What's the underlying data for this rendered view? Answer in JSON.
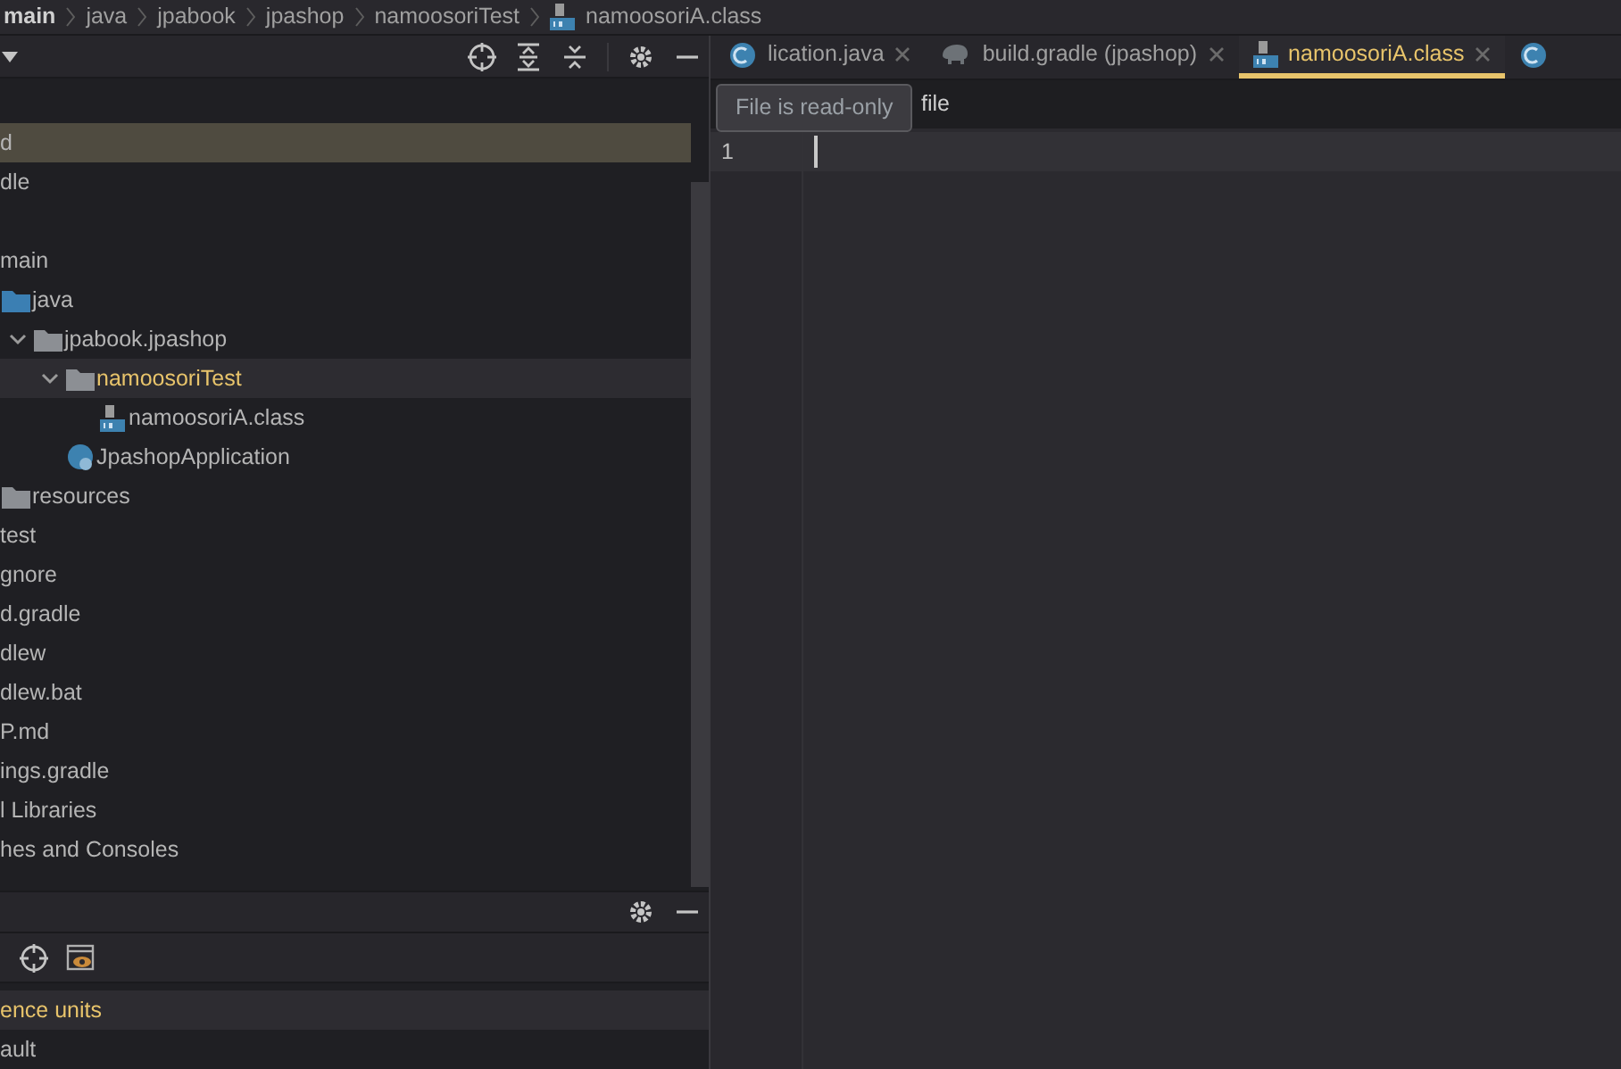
{
  "breadcrumb": [
    "main",
    "java",
    "jpabook",
    "jpashop",
    "namoosoriTest",
    {
      "label": "namoosoriA.class",
      "kind": "class"
    }
  ],
  "project_tree": [
    {
      "label": "d",
      "highlighted": true,
      "selected": false
    },
    {
      "label": "dle",
      "highlighted": false,
      "selected": false
    },
    {
      "highlighted": false,
      "selected": false,
      "children": [
        {
          "label": "main",
          "highlighted": false,
          "selected": false,
          "children": [
            {
              "label": "java",
              "kind": "source-folder",
              "highlighted": false,
              "selected": false,
              "children": [
                {
                  "label": "jpabook.jpashop",
                  "kind": "package",
                  "expanded": true,
                  "highlighted": false,
                  "selected": false,
                  "children": [
                    {
                      "label": "namoosoriTest",
                      "kind": "package",
                      "expanded": true,
                      "highlighted": false,
                      "selected": true,
                      "children": [
                        {
                          "label": "namoosoriA.class",
                          "kind": "class",
                          "highlighted": false,
                          "selected": false
                        }
                      ]
                    },
                    {
                      "label": "JpashopApplication",
                      "kind": "spring",
                      "highlighted": false,
                      "selected": false
                    }
                  ]
                }
              ]
            },
            {
              "label": "resources",
              "kind": "resources",
              "highlighted": false,
              "selected": false
            }
          ]
        },
        {
          "label": "test",
          "highlighted": false,
          "selected": false
        }
      ]
    },
    {
      "label": "gnore",
      "highlighted": false,
      "selected": false
    },
    {
      "label": "d.gradle",
      "highlighted": false,
      "selected": false
    },
    {
      "label": "dlew",
      "highlighted": false,
      "selected": false
    },
    {
      "label": "dlew.bat",
      "highlighted": false,
      "selected": false
    },
    {
      "label": "P.md",
      "highlighted": false,
      "selected": false
    },
    {
      "label": "ings.gradle",
      "highlighted": false,
      "selected": false
    },
    {
      "label": "l Libraries",
      "highlighted": false,
      "selected": false
    },
    {
      "label": "hes and Consoles",
      "highlighted": false,
      "selected": false
    }
  ],
  "bottom_panel": {
    "rows": [
      {
        "label": "ence units",
        "selected": true
      },
      {
        "label": "ault",
        "selected": false
      }
    ]
  },
  "editor_tabs": [
    {
      "label": "lication.java",
      "kind": "java",
      "selected": false
    },
    {
      "label": "build.gradle (jpashop)",
      "kind": "gradle",
      "selected": false
    },
    {
      "label": "namoosoriA.class",
      "kind": "class",
      "selected": true
    },
    {
      "kind": "spring",
      "selected": false
    }
  ],
  "tooltip": "File is read-only",
  "banner": "file",
  "editor": {
    "line_numbers": [
      "1"
    ]
  }
}
